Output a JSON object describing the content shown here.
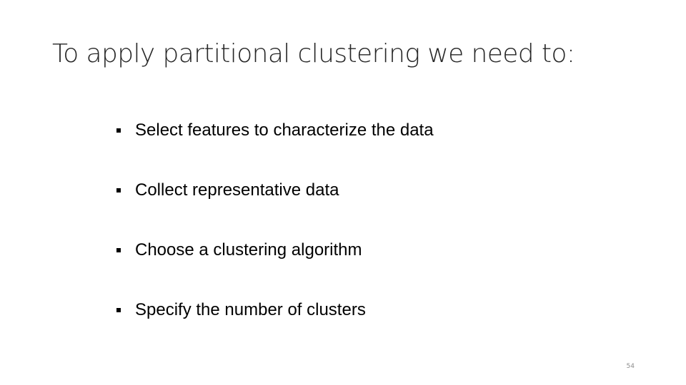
{
  "slide": {
    "title": "To apply partitional clustering we need to:",
    "bullets": [
      {
        "text": "Select features to characterize the data"
      },
      {
        "text": "Collect representative data"
      },
      {
        "text": "Choose a clustering algorithm"
      },
      {
        "text": "Specify the number of clusters"
      }
    ],
    "page_number": "54"
  },
  "icons": {
    "bullet_marker": "square-bullet-icon"
  },
  "colors": {
    "title_text": "#262626",
    "body_text": "#000000",
    "page_number": "#8c8c8c",
    "background": "#ffffff"
  }
}
